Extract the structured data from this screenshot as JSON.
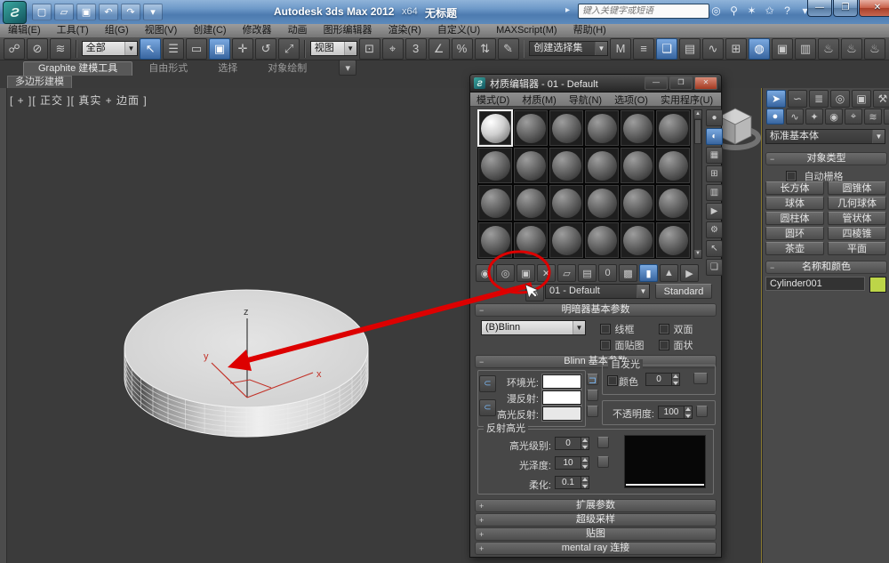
{
  "titlebar": {
    "app_title": "Autodesk 3ds Max 2012",
    "edition": "x64",
    "doc_title": "无标题",
    "search_placeholder": "键入关键字或短语",
    "quick_access": [
      {
        "name": "new-file-icon",
        "glyph": "▢"
      },
      {
        "name": "open-file-icon",
        "glyph": "▱"
      },
      {
        "name": "save-file-icon",
        "glyph": "▣"
      },
      {
        "name": "undo-icon",
        "glyph": "↶"
      },
      {
        "name": "redo-icon",
        "glyph": "↷"
      },
      {
        "name": "quick-access-dropdown-icon",
        "glyph": "▾"
      }
    ],
    "infocenter": [
      {
        "name": "search-icon",
        "glyph": "◎"
      },
      {
        "name": "license-key-icon",
        "glyph": "⚲"
      },
      {
        "name": "communication-center-icon",
        "glyph": "✶"
      },
      {
        "name": "favorites-star-icon",
        "glyph": "✩"
      },
      {
        "name": "help-icon",
        "glyph": "?"
      },
      {
        "name": "help-dropdown-icon",
        "glyph": "▾"
      }
    ],
    "window_buttons": {
      "minimize": "—",
      "restore": "❒",
      "close": "✕"
    }
  },
  "menubar": {
    "items": [
      "编辑(E)",
      "工具(T)",
      "组(G)",
      "视图(V)",
      "创建(C)",
      "修改器",
      "动画",
      "图形编辑器",
      "渲染(R)",
      "自定义(U)",
      "MAXScript(M)",
      "帮助(H)"
    ]
  },
  "toolbar": {
    "selection_filter": "全部",
    "reference_coordinate": "视图",
    "named_selection_set": "创建选择集",
    "icons_a": [
      {
        "name": "select-and-link-icon",
        "glyph": "☍"
      },
      {
        "name": "unlink-selection-icon",
        "glyph": "⊘"
      },
      {
        "name": "bind-to-space-warp-icon",
        "glyph": "≋"
      }
    ],
    "icons_b": [
      {
        "name": "select-object-icon",
        "glyph": "↖",
        "active": true
      },
      {
        "name": "select-by-name-icon",
        "glyph": "☰"
      },
      {
        "name": "rectangular-selection-region-icon",
        "glyph": "▭"
      },
      {
        "name": "window-crossing-icon",
        "glyph": "▣",
        "active": true
      },
      {
        "name": "select-and-move-icon",
        "glyph": "✛"
      },
      {
        "name": "select-and-rotate-icon",
        "glyph": "↺"
      },
      {
        "name": "select-and-scale-icon",
        "glyph": "⤢"
      }
    ],
    "icons_c": [
      {
        "name": "use-pivot-point-icon",
        "glyph": "⊡"
      },
      {
        "name": "select-and-manipulate-icon",
        "glyph": "⌖"
      },
      {
        "name": "snaps-toggle-icon",
        "glyph": "3"
      },
      {
        "name": "angle-snap-icon",
        "glyph": "∠"
      },
      {
        "name": "percent-snap-icon",
        "glyph": "%"
      },
      {
        "name": "spinner-snap-icon",
        "glyph": "⇅"
      },
      {
        "name": "edit-named-selections-icon",
        "glyph": "✎"
      }
    ],
    "icons_d": [
      {
        "name": "mirror-icon",
        "glyph": "M"
      },
      {
        "name": "align-icon",
        "glyph": "≡"
      },
      {
        "name": "layer-manager-icon",
        "glyph": "❏",
        "active": true
      },
      {
        "name": "graphite-ribbon-toggle-icon",
        "glyph": "▤"
      },
      {
        "name": "curve-editor-icon",
        "glyph": "∿"
      },
      {
        "name": "schematic-view-icon",
        "glyph": "⊞"
      },
      {
        "name": "material-editor-icon",
        "glyph": "◍",
        "active": true
      },
      {
        "name": "render-setup-icon",
        "glyph": "▣"
      },
      {
        "name": "rendered-frame-icon",
        "glyph": "▥"
      },
      {
        "name": "render-production-icon",
        "glyph": "♨"
      },
      {
        "name": "render-iterative-icon",
        "glyph": "♨"
      },
      {
        "name": "render-icon",
        "glyph": "♨"
      }
    ]
  },
  "ribbon": {
    "tabs": [
      "Graphite 建模工具",
      "自由形式",
      "选择",
      "对象绘制"
    ],
    "active_tab": "Graphite 建模工具",
    "subtab": "多边形建模"
  },
  "viewport": {
    "label": "[ + ][ 正交 ][ 真实 + 边面 ]",
    "axis": {
      "x": "x",
      "y": "y",
      "z": "z"
    }
  },
  "material_editor": {
    "title": "材质编辑器 - 01 - Default",
    "menu": [
      "模式(D)",
      "材质(M)",
      "导航(N)",
      "选项(O)",
      "实用程序(U)"
    ],
    "slots": {
      "rows": 4,
      "cols": 6,
      "selected_index": 0
    },
    "tools_vertical": [
      {
        "name": "sample-type-icon",
        "glyph": "●"
      },
      {
        "name": "backlight-icon",
        "glyph": "◐",
        "active": true
      },
      {
        "name": "background-icon",
        "glyph": "▦"
      },
      {
        "name": "sample-uv-tiling-icon",
        "glyph": "⊞"
      },
      {
        "name": "video-color-check-icon",
        "glyph": "▥"
      },
      {
        "name": "make-preview-icon",
        "glyph": "▶"
      },
      {
        "name": "material-options-icon",
        "glyph": "⚙"
      },
      {
        "name": "select-by-material-icon",
        "glyph": "↖"
      },
      {
        "name": "material-map-navigator-icon",
        "glyph": "❏"
      }
    ],
    "tools_horizontal": [
      {
        "name": "get-material-icon",
        "glyph": "◉"
      },
      {
        "name": "put-material-to-scene-icon",
        "glyph": "◎"
      },
      {
        "name": "assign-material-to-selection-icon",
        "glyph": "▣"
      },
      {
        "name": "reset-map-icon",
        "glyph": "✕"
      },
      {
        "name": "make-material-copy-icon",
        "glyph": "▱"
      },
      {
        "name": "put-to-library-icon",
        "glyph": "▤"
      },
      {
        "name": "material-id-channel-icon",
        "glyph": "0"
      },
      {
        "name": "show-shaded-material-in-viewport-icon",
        "glyph": "▩"
      },
      {
        "name": "show-end-result-icon",
        "glyph": "▮",
        "active": true
      },
      {
        "name": "go-to-parent-icon",
        "glyph": "▲"
      },
      {
        "name": "go-forward-to-sibling-icon",
        "glyph": "▶"
      }
    ],
    "pick_material_glyph": "✎",
    "material_name": "01 - Default",
    "material_type": "Standard",
    "rollouts": {
      "shader": {
        "title": "明暗器基本参数",
        "shader_type": "(B)Blinn",
        "checks": [
          "线框",
          "双面",
          "面贴图",
          "面状"
        ]
      },
      "blinn": {
        "title": "Blinn 基本参数",
        "ambient_label": "环境光:",
        "diffuse_label": "漫反射:",
        "specular_label": "高光反射:",
        "ambient_color": "#ffffff",
        "diffuse_color": "#ffffff",
        "specular_color": "#e8e8e8",
        "selfillum": {
          "title": "自发光",
          "color_label": "颜色",
          "value": "0"
        },
        "opacity": {
          "label": "不透明度:",
          "value": "100"
        }
      },
      "highlight": {
        "title": "反射高光",
        "rows": [
          {
            "label": "高光级别:",
            "value": "0"
          },
          {
            "label": "光泽度:",
            "value": "10"
          },
          {
            "label": "柔化:",
            "value": "0.1"
          }
        ]
      },
      "collapsed": [
        "扩展参数",
        "超级采样",
        "贴图",
        "mental ray 连接"
      ]
    }
  },
  "command_panel": {
    "tabs": [
      {
        "name": "create-tab-icon",
        "glyph": "➤",
        "active": true
      },
      {
        "name": "modify-tab-icon",
        "glyph": "∽"
      },
      {
        "name": "hierarchy-tab-icon",
        "glyph": "≣"
      },
      {
        "name": "motion-tab-icon",
        "glyph": "◎"
      },
      {
        "name": "display-tab-icon",
        "glyph": "▣"
      },
      {
        "name": "utilities-tab-icon",
        "glyph": "⚒"
      }
    ],
    "categories": [
      {
        "name": "geometry-category-icon",
        "glyph": "●",
        "active": true
      },
      {
        "name": "shapes-category-icon",
        "glyph": "∿"
      },
      {
        "name": "lights-category-icon",
        "glyph": "✦"
      },
      {
        "name": "cameras-category-icon",
        "glyph": "◉"
      },
      {
        "name": "helpers-category-icon",
        "glyph": "⌖"
      },
      {
        "name": "space-warps-category-icon",
        "glyph": "≋"
      },
      {
        "name": "systems-category-icon",
        "glyph": "⚙"
      }
    ],
    "category_dropdown": "标准基本体",
    "object_type": {
      "title": "对象类型",
      "autogrid": "自动栅格",
      "buttons": [
        "长方体",
        "圆锥体",
        "球体",
        "几何球体",
        "圆柱体",
        "管状体",
        "圆环",
        "四棱锥",
        "茶壶",
        "平面"
      ]
    },
    "name_color": {
      "title": "名称和颜色",
      "name": "Cylinder001",
      "color": "#bdd548"
    }
  },
  "annotations": {
    "color": "#dd0000"
  }
}
